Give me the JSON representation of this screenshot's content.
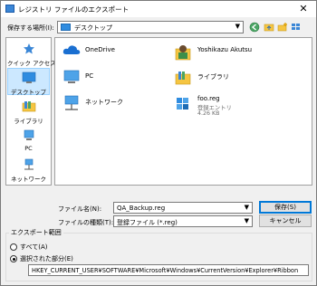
{
  "window": {
    "title": "レジストリ ファイルのエクスポート",
    "close_glyph": "✕"
  },
  "save_in": {
    "label": "保存する場所(I):",
    "value": "デスクトップ"
  },
  "sidebar": {
    "items": [
      {
        "label": "クイック アクセス",
        "icon": "star-icon"
      },
      {
        "label": "デスクトップ",
        "icon": "desktop-icon"
      },
      {
        "label": "ライブラリ",
        "icon": "library-icon"
      },
      {
        "label": "PC",
        "icon": "pc-icon"
      },
      {
        "label": "ネットワーク",
        "icon": "network-icon"
      }
    ]
  },
  "files": {
    "onedrive": {
      "name": "OneDrive"
    },
    "user": {
      "name": "Yoshikazu Akutsu"
    },
    "pc": {
      "name": "PC"
    },
    "library": {
      "name": "ライブラリ"
    },
    "network": {
      "name": "ネットワーク"
    },
    "reg": {
      "name": "foo.reg",
      "type": "登録エントリ",
      "size": "4.26 KB"
    }
  },
  "filename": {
    "label": "ファイル名(N):",
    "value": "QA_Backup.reg"
  },
  "filetype": {
    "label": "ファイルの種類(T):",
    "value": "登録ファイル (*.reg)"
  },
  "buttons": {
    "save": "保存(S)",
    "cancel": "キャンセル"
  },
  "export_range": {
    "title": "エクスポート範囲",
    "all_label": "すべて(A)",
    "selected_label": "選択された部分(E)",
    "selected_branch": "HKEY_CURRENT_USER¥SOFTWARE¥Microsoft¥Windows¥CurrentVersion¥Explorer¥Ribbon"
  },
  "colors": {
    "accent": "#0078d7",
    "selection_bg": "#cce8ff",
    "folder": "#f5c542"
  }
}
